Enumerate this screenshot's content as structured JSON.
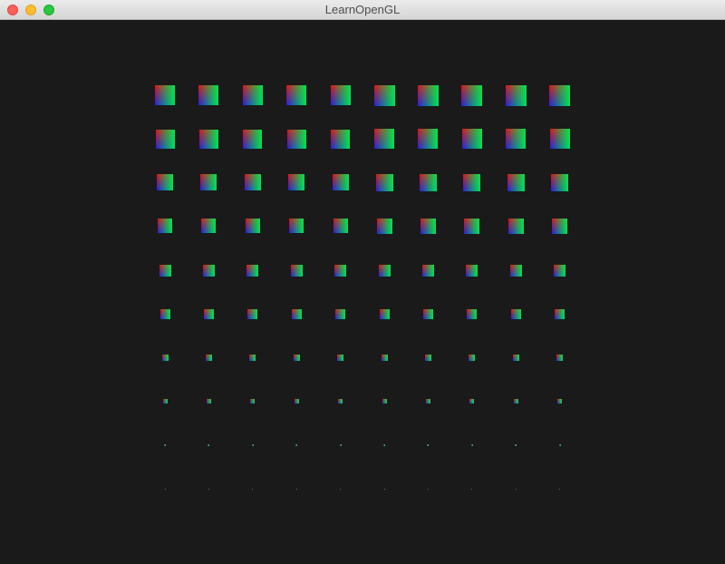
{
  "window": {
    "title": "LearnOpenGL",
    "background": "#1a1a1a"
  },
  "controls": {
    "close": "close-icon",
    "minimize": "minimize-icon",
    "zoom": "zoom-icon"
  },
  "scene": {
    "rows": 10,
    "columns": 10,
    "quad_colors": {
      "top_left": "#e0141b",
      "bottom_left": "#2a1cdc",
      "right": "#00e650"
    }
  }
}
